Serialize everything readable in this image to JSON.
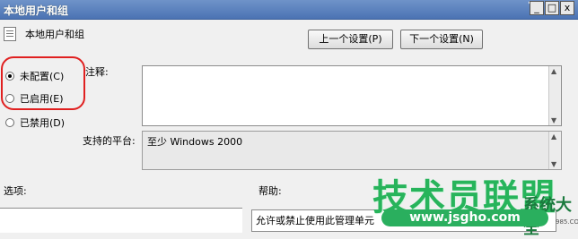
{
  "window": {
    "title": "本地用户和组",
    "help_glyph": "?",
    "controls": [
      "_",
      "□",
      "x"
    ]
  },
  "policy": {
    "name": "本地用户和组"
  },
  "nav": {
    "prev_label": "上一个设置(P)",
    "next_label": "下一个设置(N)"
  },
  "options": [
    {
      "label": "未配置(C)",
      "checked": true
    },
    {
      "label": "已启用(E)",
      "checked": false
    },
    {
      "label": "已禁用(D)",
      "checked": false
    }
  ],
  "labels": {
    "comment": "注释:",
    "supported_platform": "支持的平台:",
    "options_section": "选项:",
    "help_section": "帮助:"
  },
  "supported_platform_value": "至少 Windows 2000",
  "help_text": "允许或禁止使用此管理单元",
  "watermark": {
    "brand": "技术员联盟",
    "side_text": "系统大全",
    "url": "www.jsgho.com",
    "number": "985.COM"
  },
  "colors": {
    "highlight": "#e02020",
    "title_bar": "#5a80c0",
    "watermark_green": "#27b45b"
  }
}
